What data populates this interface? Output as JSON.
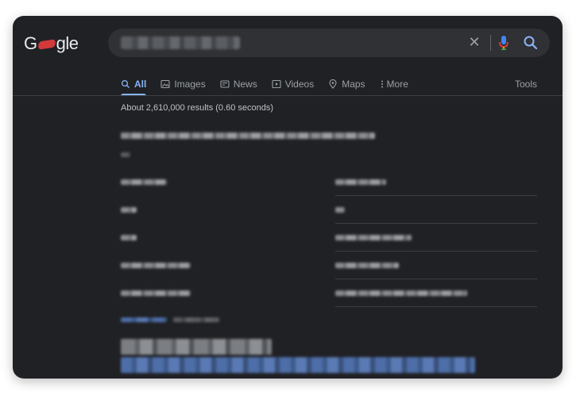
{
  "brand": {
    "logo_left": "G",
    "logo_right": "gle"
  },
  "search": {
    "query": ""
  },
  "tabs": [
    {
      "label": "All",
      "icon": "search-icon",
      "active": true
    },
    {
      "label": "Images",
      "icon": "image-icon",
      "active": false
    },
    {
      "label": "News",
      "icon": "news-icon",
      "active": false
    },
    {
      "label": "Videos",
      "icon": "play-icon",
      "active": false
    },
    {
      "label": "Maps",
      "icon": "map-pin-icon",
      "active": false
    },
    {
      "label": "More",
      "icon": "more-vert-icon",
      "active": false
    }
  ],
  "tools_label": "Tools",
  "results_stats": "About 2,610,000 results (0.60 seconds)",
  "colors": {
    "background": "#202124",
    "search_box": "#303134",
    "accent": "#8ab4f8",
    "text_muted": "#9aa0a6",
    "text": "#bdc1c6"
  }
}
